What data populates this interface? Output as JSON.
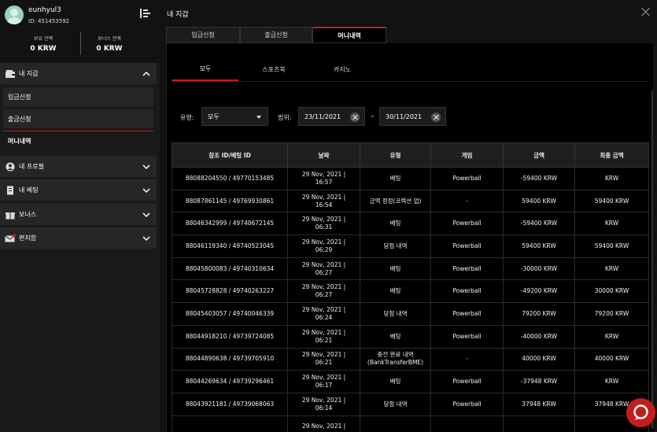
{
  "profile": {
    "username": "eunhyul3",
    "user_id": "ID: 451453592",
    "balances": [
      {
        "label": "보유 잔액",
        "value": "0 KRW"
      },
      {
        "label": "보너스 잔액",
        "value": "0 KRW"
      }
    ]
  },
  "sidebar": {
    "wallet": {
      "label": "내 지갑",
      "icon": "wallet-icon",
      "chevron": "chevron-up"
    },
    "submenu": [
      {
        "label": "입금신청"
      },
      {
        "label": "출금신청"
      },
      {
        "label": "머니내역"
      }
    ],
    "items": [
      {
        "label": "내 프로필",
        "icon": "user-icon"
      },
      {
        "label": "내 베팅",
        "icon": "betslip-icon"
      },
      {
        "label": "보너스",
        "icon": "gift-icon"
      },
      {
        "label": "편지함",
        "icon": "mail-icon"
      }
    ]
  },
  "panel": {
    "title": "내 지갑",
    "tabs": [
      {
        "label": "입금신청"
      },
      {
        "label": "출금신청"
      },
      {
        "label": "머니내역",
        "active": true
      }
    ],
    "subtabs": [
      {
        "label": "모두",
        "active": true
      },
      {
        "label": "스포츠북"
      },
      {
        "label": "카지노"
      }
    ],
    "filters": {
      "type_label": "유형:",
      "type_value": "모두",
      "range_label": "범위:",
      "date_from": "23/11/2021",
      "date_to": "30/11/2021",
      "separator": "–"
    }
  },
  "table": {
    "headers": [
      "참조 ID/베팅 ID",
      "날짜",
      "유형",
      "게임",
      "금액",
      "최종 금액"
    ],
    "rows": [
      {
        "ref": "88088204550 / 49770153485",
        "date1": "29 Nov, 2021 |",
        "date2": "16:57",
        "type1": "베팅",
        "type2": "",
        "game": "Powerball",
        "amount": "-59400 KRW",
        "final": "KRW"
      },
      {
        "ref": "88087861145 / 49769930861",
        "date1": "29 Nov, 2021 |",
        "date2": "16:54",
        "type1": "금액 정정(코렉션 업)",
        "type2": "",
        "game": "-",
        "amount": "59400 KRW",
        "final": "59400 KRW"
      },
      {
        "ref": "88046342999 / 49740672145",
        "date1": "29 Nov, 2021 |",
        "date2": "06:31",
        "type1": "베팅",
        "type2": "",
        "game": "Powerball",
        "amount": "-59400 KRW",
        "final": "KRW"
      },
      {
        "ref": "88046119340 / 49740523045",
        "date1": "29 Nov, 2021 |",
        "date2": "06:29",
        "type1": "당첨 내역",
        "type2": "",
        "game": "Powerball",
        "amount": "59400 KRW",
        "final": "59400 KRW"
      },
      {
        "ref": "88045800083 / 49740310634",
        "date1": "29 Nov, 2021 |",
        "date2": "06:27",
        "type1": "베팅",
        "type2": "",
        "game": "Powerball",
        "amount": "-30000 KRW",
        "final": "KRW"
      },
      {
        "ref": "88045728828 / 49740263227",
        "date1": "29 Nov, 2021 |",
        "date2": "06:27",
        "type1": "베팅",
        "type2": "",
        "game": "Powerball",
        "amount": "-49200 KRW",
        "final": "30000 KRW"
      },
      {
        "ref": "88045403057 / 49740046339",
        "date1": "29 Nov, 2021 |",
        "date2": "06:24",
        "type1": "당첨 내역",
        "type2": "",
        "game": "Powerball",
        "amount": "79200 KRW",
        "final": "79200 KRW"
      },
      {
        "ref": "88044918210 / 49739724085",
        "date1": "29 Nov, 2021 |",
        "date2": "06:21",
        "type1": "베팅",
        "type2": "",
        "game": "Powerball",
        "amount": "-40000 KRW",
        "final": "KRW"
      },
      {
        "ref": "88044890638 / 49739705910",
        "date1": "29 Nov, 2021 |",
        "date2": "06:21",
        "type1": "충전 완료 내역",
        "type2": "(BankTransferBME)",
        "game": "-",
        "amount": "40000 KRW",
        "final": "40000 KRW"
      },
      {
        "ref": "88044269634 / 49739296461",
        "date1": "29 Nov, 2021 |",
        "date2": "06:17",
        "type1": "베팅",
        "type2": "",
        "game": "Powerball",
        "amount": "-37948 KRW",
        "final": "KRW"
      },
      {
        "ref": "88043921181 / 49739068063",
        "date1": "29 Nov, 2021 |",
        "date2": "06:14",
        "type1": "당첨 내역",
        "type2": "",
        "game": "Powerball",
        "amount": "37948 KRW",
        "final": "37948 KRW"
      },
      {
        "ref": "",
        "date1": "29 Nov, 2021 |",
        "date2": "",
        "type1": "",
        "type2": "",
        "game": "",
        "amount": "",
        "final": ""
      }
    ]
  },
  "colors": {
    "accent": "#d11a1a",
    "chat": "#c51d1d"
  }
}
